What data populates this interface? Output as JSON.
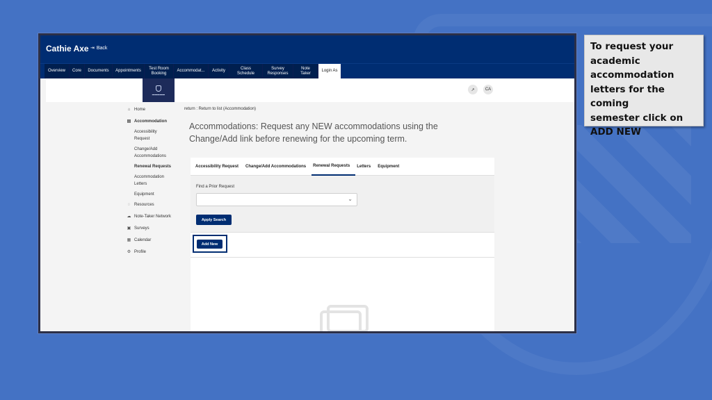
{
  "colors": {
    "slide_background": "#4472c4",
    "portal_navy": "#002d72",
    "callout_background": "#e8e8e8"
  },
  "header": {
    "user_name": "Cathie Axe",
    "back_label": "Back",
    "back_icon": "exit-arrow-icon"
  },
  "nav": {
    "items": [
      {
        "label": "Overview"
      },
      {
        "label": "Core"
      },
      {
        "label": "Documents"
      },
      {
        "label": "Appointments"
      },
      {
        "label": "Test Room\nBooking"
      },
      {
        "label": "Accommodat..."
      },
      {
        "label": "Activity"
      },
      {
        "label": "Class Schedule"
      },
      {
        "label": "Survey\nResponses"
      },
      {
        "label": "Note Taker"
      },
      {
        "label": "Login As",
        "active": true
      }
    ]
  },
  "top_right": {
    "external_icon": "external-link-icon",
    "avatar_initials": "CA"
  },
  "sidebar": {
    "home": "Home",
    "accommodation": "Accommodation",
    "sub": [
      "Accessibility\nRequest",
      "Change/Add\nAccommodations",
      "Renewal Requests",
      "Accommodation\nLetters",
      "Equipment"
    ],
    "resources": "Resources",
    "note_taker_network": "Note-Taker Network",
    "surveys": "Surveys",
    "calendar": "Calendar",
    "profile": "Profile"
  },
  "breadcrumb": "return : Return to list (Accommodation)",
  "page_title": "Accommodations: Request any NEW accommodations using the Change/Add link before renewing for the upcoming term.",
  "tabs": [
    "Accessibility Request",
    "Change/Add Accommodations",
    "Renewal Requests",
    "Letters",
    "Equipment"
  ],
  "active_tab": "Renewal Requests",
  "filter": {
    "label": "Find a Prior Request",
    "selected": "",
    "apply_label": "Apply Search"
  },
  "add_new_label": "Add New",
  "callout": "To request your\nacademic\naccommodation\nletters for the coming\nsemester click on\nADD NEW"
}
